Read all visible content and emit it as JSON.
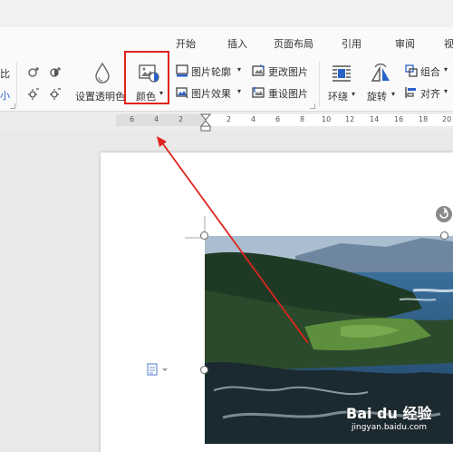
{
  "tabs": [
    "开始",
    "插入",
    "页面布局",
    "引用",
    "审阅",
    "视"
  ],
  "ribbon": {
    "left_cut_label_1": "比",
    "left_cut_label_2": "小",
    "set_transparent_label": "设置透明色",
    "color_label": "颜色",
    "picture_outline_label": "图片轮廓",
    "picture_effects_label": "图片效果",
    "change_picture_label": "更改图片",
    "reset_picture_label": "重设图片",
    "wrap_label": "环绕",
    "rotate_label": "旋转",
    "group_label": "组合",
    "align_label": "对齐"
  },
  "ruler": {
    "left_numbers": [
      "6",
      "4",
      "2"
    ],
    "right_numbers": [
      "2",
      "4",
      "6",
      "8",
      "10",
      "12",
      "14",
      "16",
      "18",
      "20"
    ]
  },
  "watermark": {
    "main": "Bai du 经验",
    "sub": "jingyan.baidu.com"
  },
  "colors": {
    "highlight": "#e0231c",
    "arrow": "#e0231c",
    "outline_icon_blue": "#2a62c9"
  }
}
